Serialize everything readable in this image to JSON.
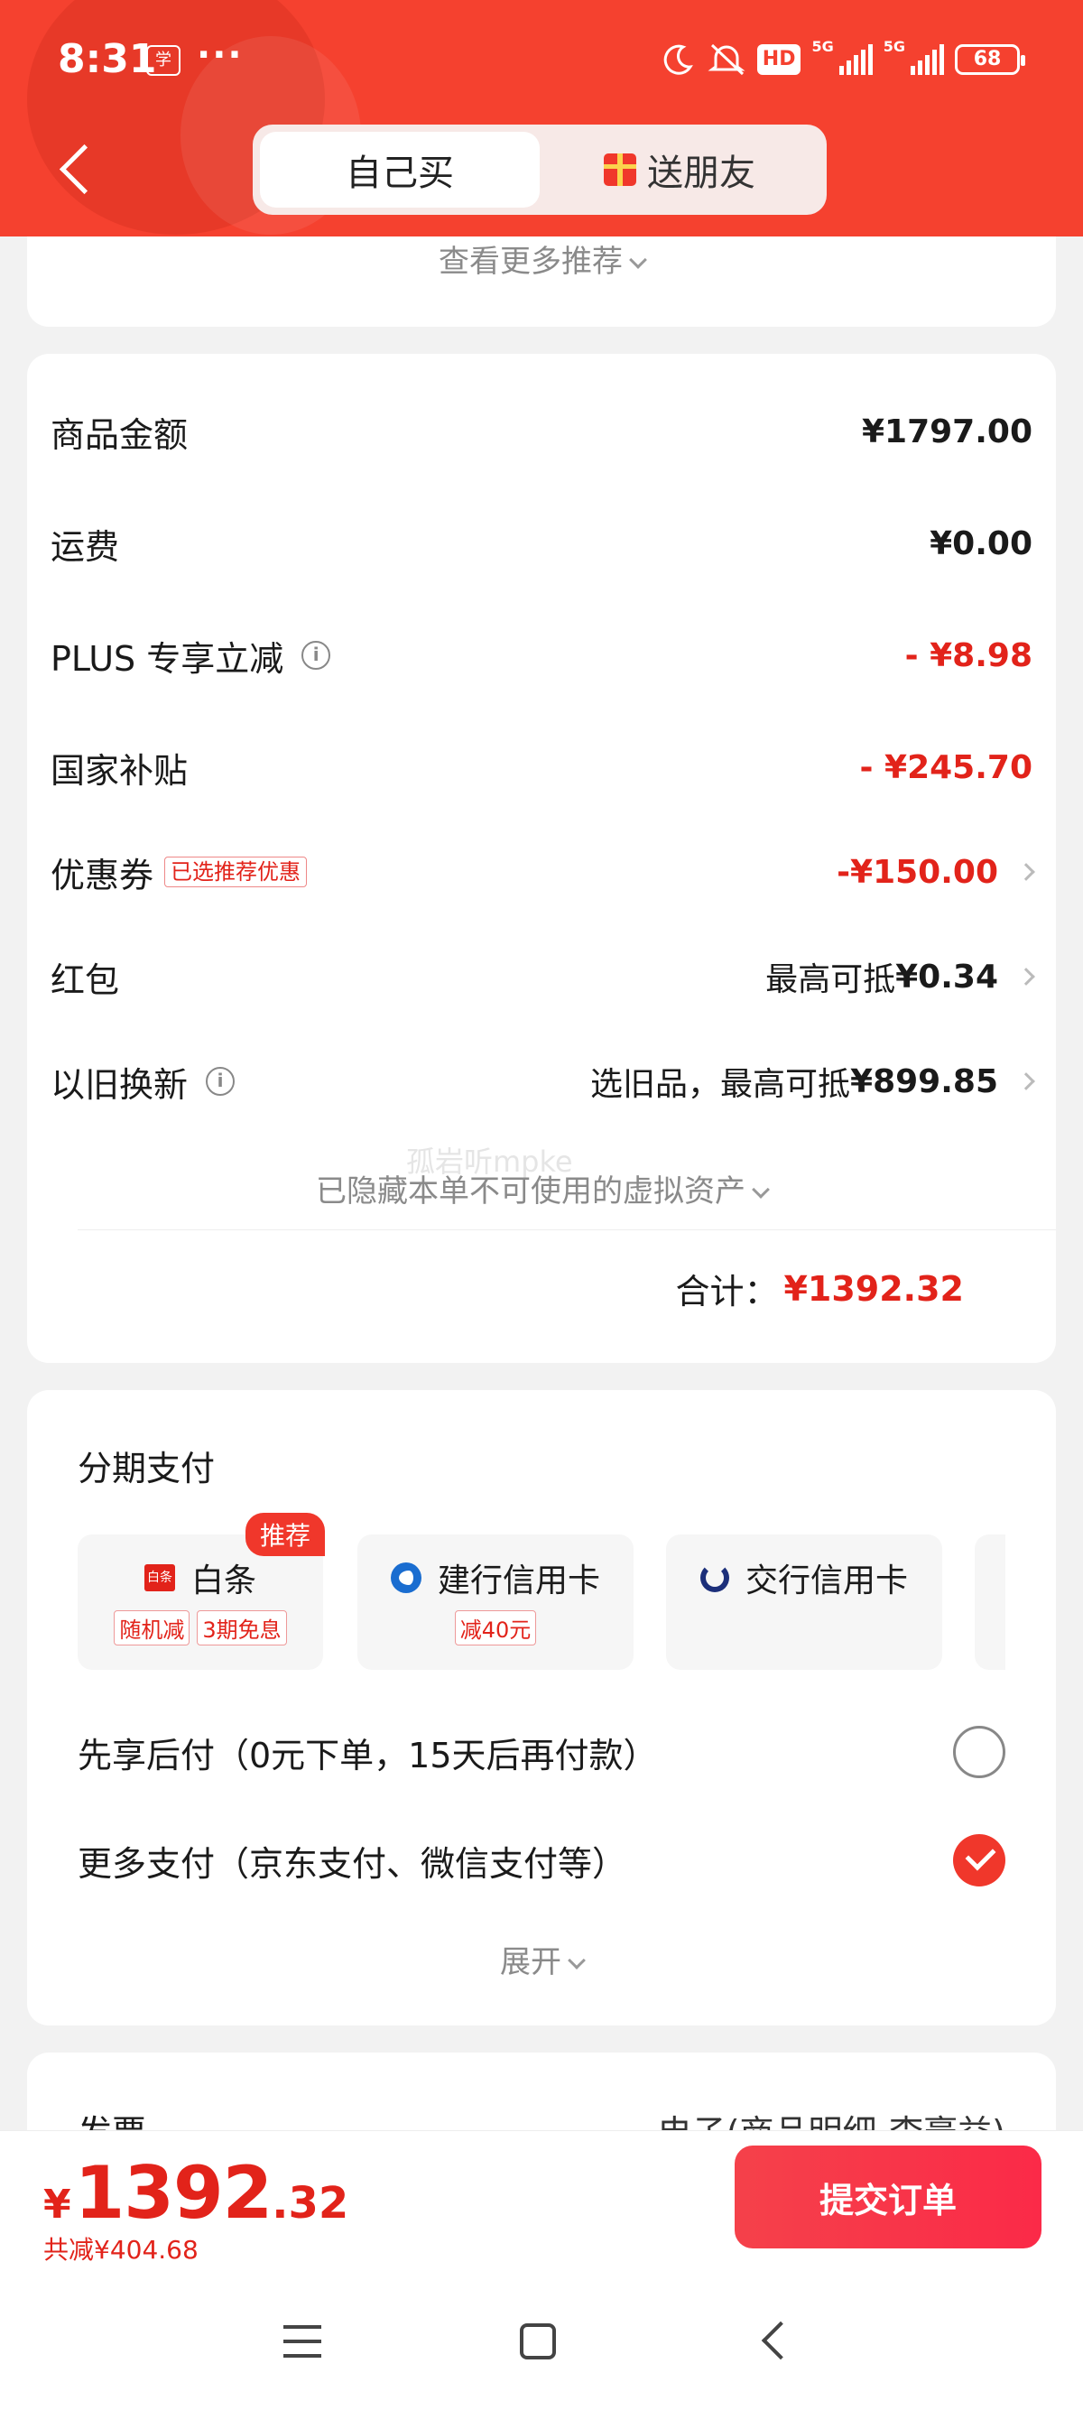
{
  "status_bar": {
    "time": "8:31",
    "app_mini": "学",
    "dots": "···",
    "hd": "HD",
    "net1": "5G",
    "net2": "5G",
    "battery": "68"
  },
  "header": {
    "tabs": [
      {
        "label": "自己买",
        "active": true
      },
      {
        "label": "送朋友",
        "active": false
      }
    ]
  },
  "top_card": {
    "more_recommend": "查看更多推荐"
  },
  "summary": {
    "rows": [
      {
        "label": "商品金额",
        "value": "¥1797.00"
      },
      {
        "label": "运费",
        "value": "¥0.00"
      },
      {
        "label": "PLUS 专享立减",
        "value": "- ¥8.98"
      },
      {
        "label": "国家补贴",
        "value": "- ¥245.70"
      },
      {
        "label": "优惠券",
        "tag": "已选推荐优惠",
        "value": "-¥150.00"
      },
      {
        "label": "红包",
        "value_prefix": "最高可抵",
        "value": "¥0.34"
      },
      {
        "label": "以旧换新",
        "value_prefix": "选旧品，最高可抵",
        "value": "¥899.85"
      }
    ],
    "hidden_assets": "已隐藏本单不可使用的虚拟资产",
    "watermark": "孤岩听mpke",
    "total_label": "合计：",
    "total_value": "¥1392.32"
  },
  "payment": {
    "title": "分期支付",
    "options": [
      {
        "name": "白条",
        "icon_text": "白条",
        "badges": [
          "随机减",
          "3期免息"
        ],
        "flag": "推荐"
      },
      {
        "name": "建行信用卡",
        "badges": [
          "减40元"
        ]
      },
      {
        "name": "交行信用卡",
        "badges": []
      }
    ],
    "later_pay": "先享后付（0元下单，15天后再付款）",
    "more_pay": "更多支付（京东支付、微信支付等）",
    "expand": "展开"
  },
  "invoice": {
    "label": "发票",
    "value": "电子(商品明细-李豪益)"
  },
  "bottom": {
    "yen": "¥",
    "price_int": "1392",
    "price_dec": ".32",
    "saved": "共减¥404.68",
    "submit": "提交订单"
  },
  "colors": {
    "brand_red": "#f5412f",
    "price_red": "#e2231a"
  }
}
